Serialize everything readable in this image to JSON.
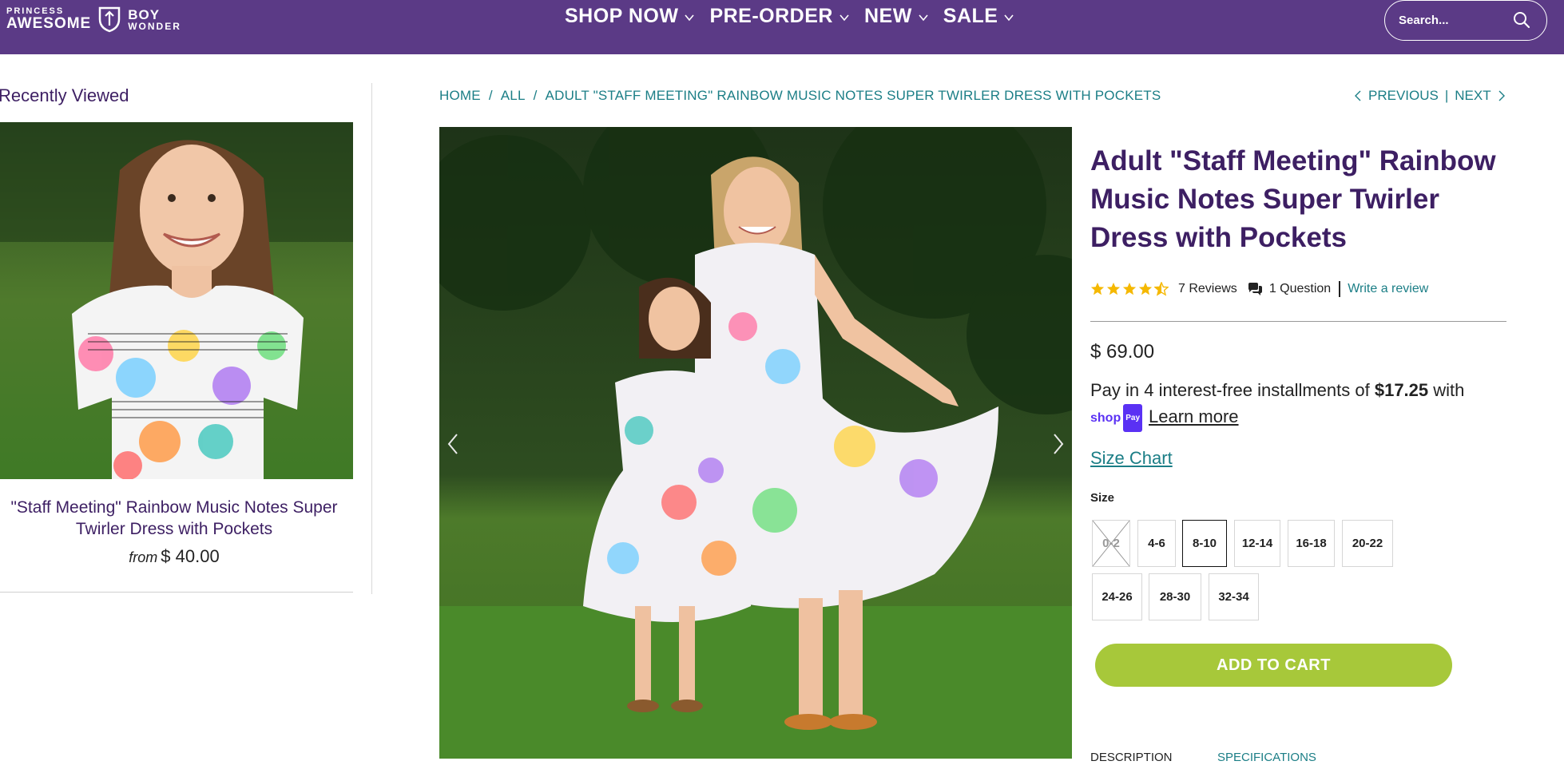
{
  "brand": {
    "left_small": "PRINCESS",
    "left_big": "AWESOME",
    "right_big": "BOY",
    "right_small": "WONDER"
  },
  "nav": {
    "items": [
      {
        "label": "SHOP NOW"
      },
      {
        "label": "PRE-ORDER"
      },
      {
        "label": "NEW"
      },
      {
        "label": "SALE"
      }
    ]
  },
  "search": {
    "placeholder": "Search..."
  },
  "sidebar": {
    "title": "Recently Viewed",
    "product_name": "\"Staff Meeting\" Rainbow Music Notes Super Twirler Dress with Pockets",
    "from_label": "from",
    "price": "$ 40.00"
  },
  "breadcrumb": {
    "items": [
      "HOME",
      "ALL",
      "ADULT \"STAFF MEETING\" RAINBOW MUSIC NOTES SUPER TWIRLER DRESS WITH POCKETS"
    ],
    "separator": "/"
  },
  "pager": {
    "previous": "PREVIOUS",
    "separator": "|",
    "next": "NEXT"
  },
  "product": {
    "title": "Adult \"Staff Meeting\" Rainbow Music Notes Super Twirler Dress with Pockets",
    "rating": 4.5,
    "reviews": "7 Reviews",
    "questions": "1 Question",
    "write_review": "Write a review",
    "price": "$ 69.00",
    "installments_prefix": "Pay in 4 interest-free installments of",
    "installments_amount": "$17.25",
    "installments_suffix": "with",
    "shop_pay_label": "shop",
    "shop_pay_badge": "Pay",
    "learn_more": "Learn more",
    "size_chart": "Size Chart",
    "size_label": "Size",
    "sizes": [
      {
        "label": "0-2",
        "available": false,
        "selected": false
      },
      {
        "label": "4-6",
        "available": true,
        "selected": false
      },
      {
        "label": "8-10",
        "available": true,
        "selected": true
      },
      {
        "label": "12-14",
        "available": true,
        "selected": false
      },
      {
        "label": "16-18",
        "available": true,
        "selected": false
      },
      {
        "label": "20-22",
        "available": true,
        "selected": false
      },
      {
        "label": "24-26",
        "available": true,
        "selected": false
      },
      {
        "label": "28-30",
        "available": true,
        "selected": false
      },
      {
        "label": "32-34",
        "available": true,
        "selected": false
      }
    ],
    "add_to_cart": "ADD TO CART"
  },
  "tabs": {
    "description": "DESCRIPTION",
    "specifications": "SPECIFICATIONS"
  },
  "colors": {
    "header_bg": "#5b3a86",
    "title_purple": "#3d1f63",
    "link_teal": "#1b7e86",
    "star_yellow": "#f5b800",
    "cart_green": "#a7c83a"
  }
}
